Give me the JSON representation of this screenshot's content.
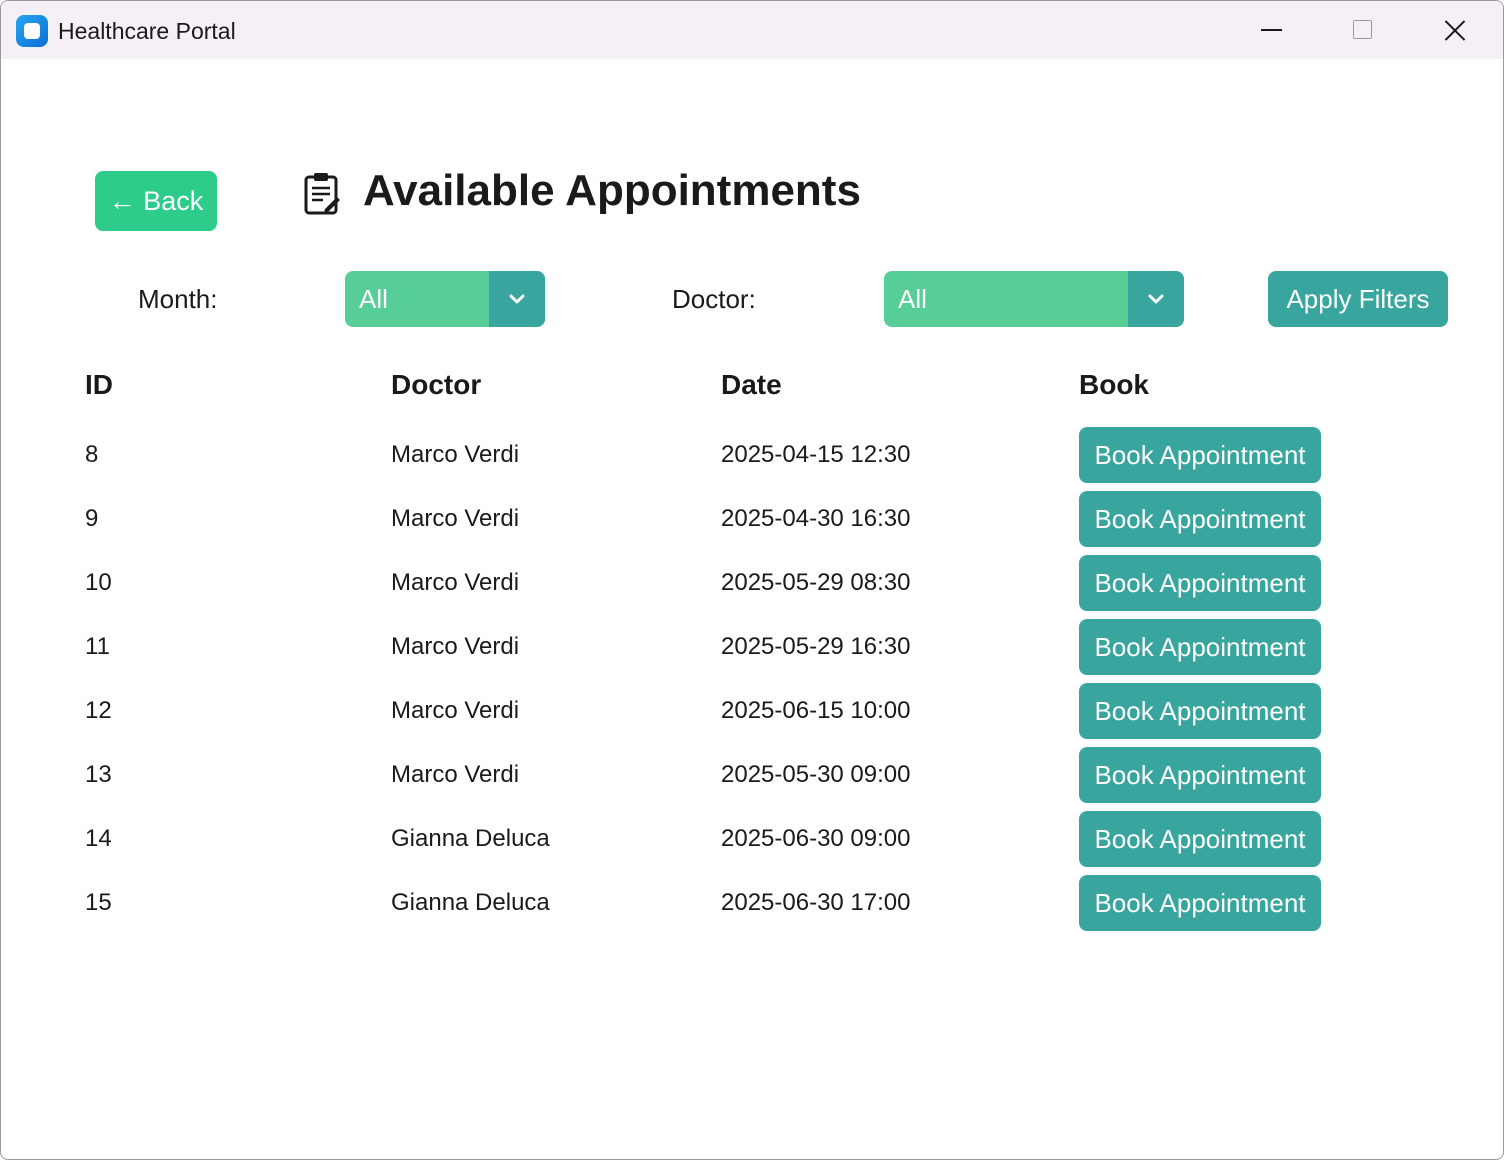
{
  "window": {
    "title": "Healthcare Portal"
  },
  "header": {
    "back_label": "← Back",
    "title": "Available Appointments"
  },
  "filters": {
    "month_label": "Month:",
    "month_value": "All",
    "doctor_label": "Doctor:",
    "doctor_value": "All",
    "apply_label": "Apply Filters"
  },
  "table": {
    "headers": [
      "ID",
      "Doctor",
      "Date",
      "Book"
    ],
    "rows": [
      {
        "id": "8",
        "doctor": "Marco Verdi",
        "date": "2025-04-15 12:30",
        "action": "Book Appointment"
      },
      {
        "id": "9",
        "doctor": "Marco Verdi",
        "date": "2025-04-30 16:30",
        "action": "Book Appointment"
      },
      {
        "id": "10",
        "doctor": "Marco Verdi",
        "date": "2025-05-29 08:30",
        "action": "Book Appointment"
      },
      {
        "id": "11",
        "doctor": "Marco Verdi",
        "date": "2025-05-29 16:30",
        "action": "Book Appointment"
      },
      {
        "id": "12",
        "doctor": "Marco Verdi",
        "date": "2025-06-15 10:00",
        "action": "Book Appointment"
      },
      {
        "id": "13",
        "doctor": "Marco Verdi",
        "date": "2025-05-30 09:00",
        "action": "Book Appointment"
      },
      {
        "id": "14",
        "doctor": "Gianna Deluca",
        "date": "2025-06-30 09:00",
        "action": "Book Appointment"
      },
      {
        "id": "15",
        "doctor": "Gianna Deluca",
        "date": "2025-06-30 17:00",
        "action": "Book Appointment"
      }
    ]
  },
  "icons": {
    "app": "app-icon",
    "title": "clipboard-icon",
    "dropdown": "chevron-down-icon"
  },
  "colors": {
    "primary_green": "#2ecc8a",
    "select_green": "#57ce98",
    "teal": "#38a69f",
    "titlebar_bg": "#f5f0f5"
  }
}
